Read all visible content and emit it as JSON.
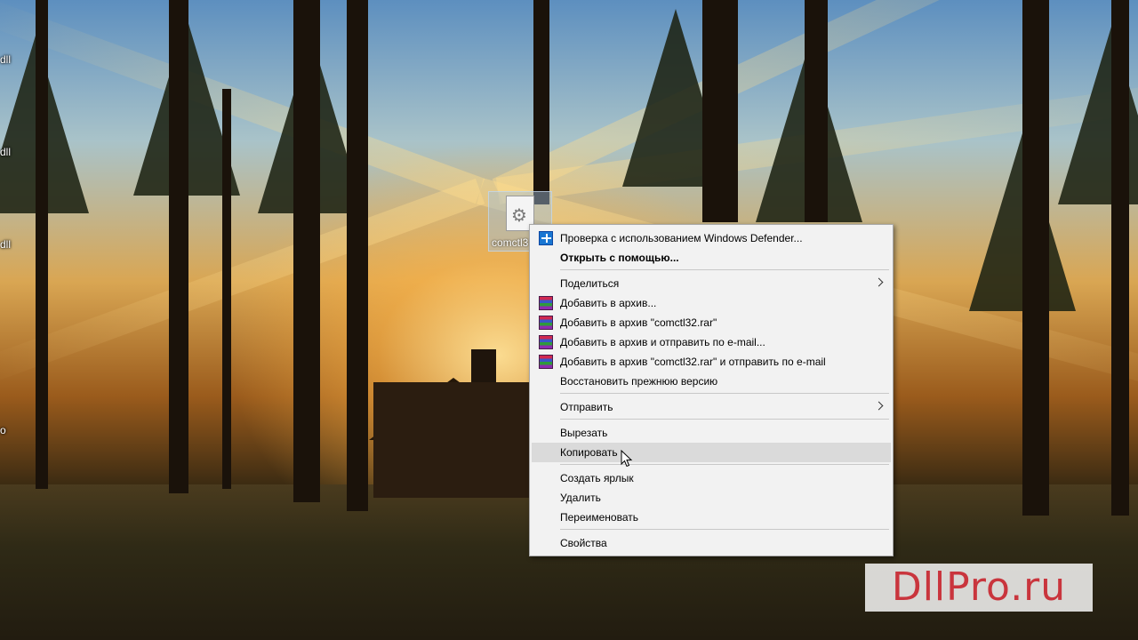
{
  "desktop": {
    "left_edge_labels": [
      "dll",
      "dll",
      "dll",
      "o"
    ],
    "file": {
      "name": "comctl3",
      "icon": "dll-gear-file-icon"
    }
  },
  "context_menu": {
    "items": [
      {
        "label": "Проверка с использованием Windows Defender...",
        "icon": "windows-defender-icon"
      },
      {
        "label": "Открыть с помощью...",
        "bold": true
      },
      {
        "label": "Поделиться",
        "submenu": true
      },
      {
        "label": "Добавить в архив...",
        "icon": "winrar-icon"
      },
      {
        "label": "Добавить в архив \"comctl32.rar\"",
        "icon": "winrar-icon"
      },
      {
        "label": "Добавить в архив и отправить по e-mail...",
        "icon": "winrar-icon"
      },
      {
        "label": "Добавить в архив \"comctl32.rar\" и отправить по e-mail",
        "icon": "winrar-icon"
      },
      {
        "label": "Восстановить прежнюю версию"
      },
      {
        "label": "Отправить",
        "submenu": true
      },
      {
        "label": "Вырезать"
      },
      {
        "label": "Копировать",
        "hovered": true
      },
      {
        "label": "Создать ярлык"
      },
      {
        "label": "Удалить"
      },
      {
        "label": "Переименовать"
      },
      {
        "label": "Свойства"
      }
    ]
  },
  "watermark": {
    "text": "DllPro.ru",
    "color": "#c9353d"
  },
  "colors": {
    "menu_background": "#f2f2f2",
    "menu_hover": "#dadada",
    "menu_border": "#a8a8a8"
  }
}
